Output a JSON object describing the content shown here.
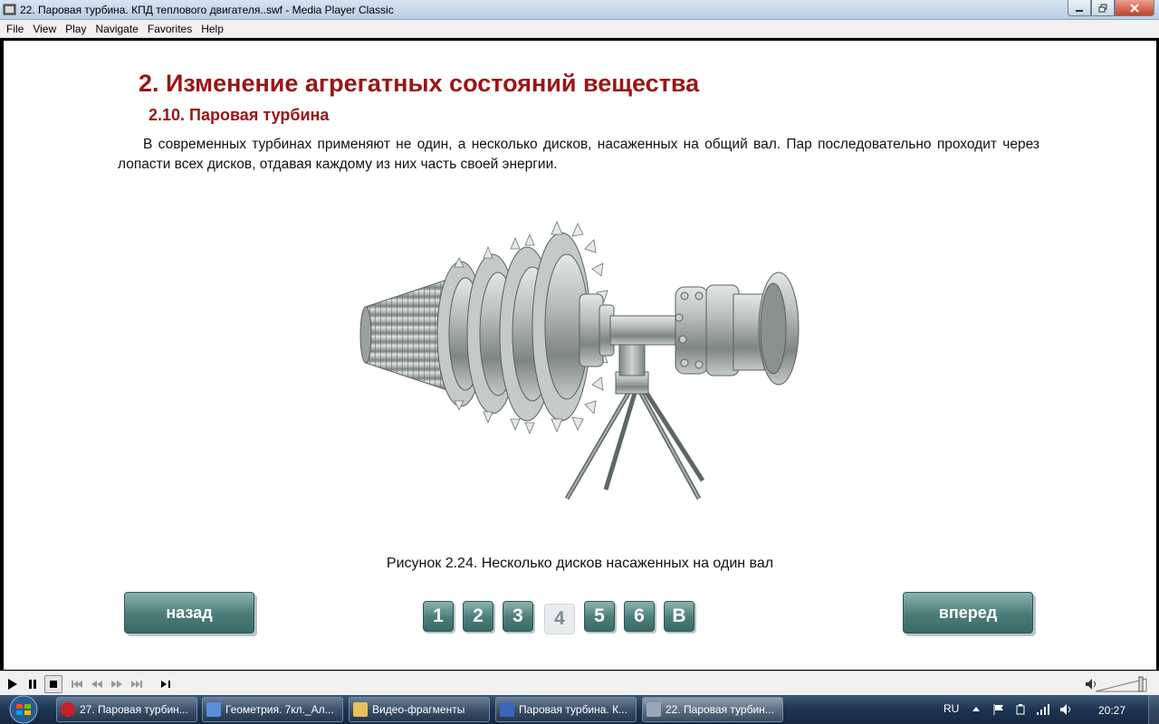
{
  "window": {
    "title": "22. Паровая турбина. КПД теплового двигателя..swf - Media Player Classic"
  },
  "menu": [
    "File",
    "View",
    "Play",
    "Navigate",
    "Favorites",
    "Help"
  ],
  "slide": {
    "heading": "2. Изменение агрегатных состояний вещества",
    "subheading": "2.10. Паровая турбина",
    "paragraph": "В современных турбинах применяют не один, а несколько дисков, насаженных на общий вал. Пар последовательно проходит через лопасти всех дисков, отдавая каждому из них часть своей энергии.",
    "caption": "Рисунок 2.24. Несколько дисков насаженных на один вал",
    "back_label": "назад",
    "forward_label": "вперед",
    "pages": [
      "1",
      "2",
      "3",
      "4",
      "5",
      "6",
      "В"
    ],
    "active_page": "4"
  },
  "taskbar": {
    "tasks": [
      {
        "label": "27. Паровая турбин...",
        "icon": "opera-icon",
        "color": "#c8202a"
      },
      {
        "label": "Геометрия. 7кл._Ал...",
        "icon": "edit-icon",
        "color": "#5b8fd6"
      },
      {
        "label": "Видео-фрагменты",
        "icon": "folder-icon",
        "color": "#e8c15a"
      },
      {
        "label": "Паровая турбина. К...",
        "icon": "word-icon",
        "color": "#3a66b8"
      },
      {
        "label": "22. Паровая турбин...",
        "icon": "media-player-icon",
        "color": "#9aa7b5"
      }
    ],
    "language": "RU",
    "clock": "20:27"
  }
}
